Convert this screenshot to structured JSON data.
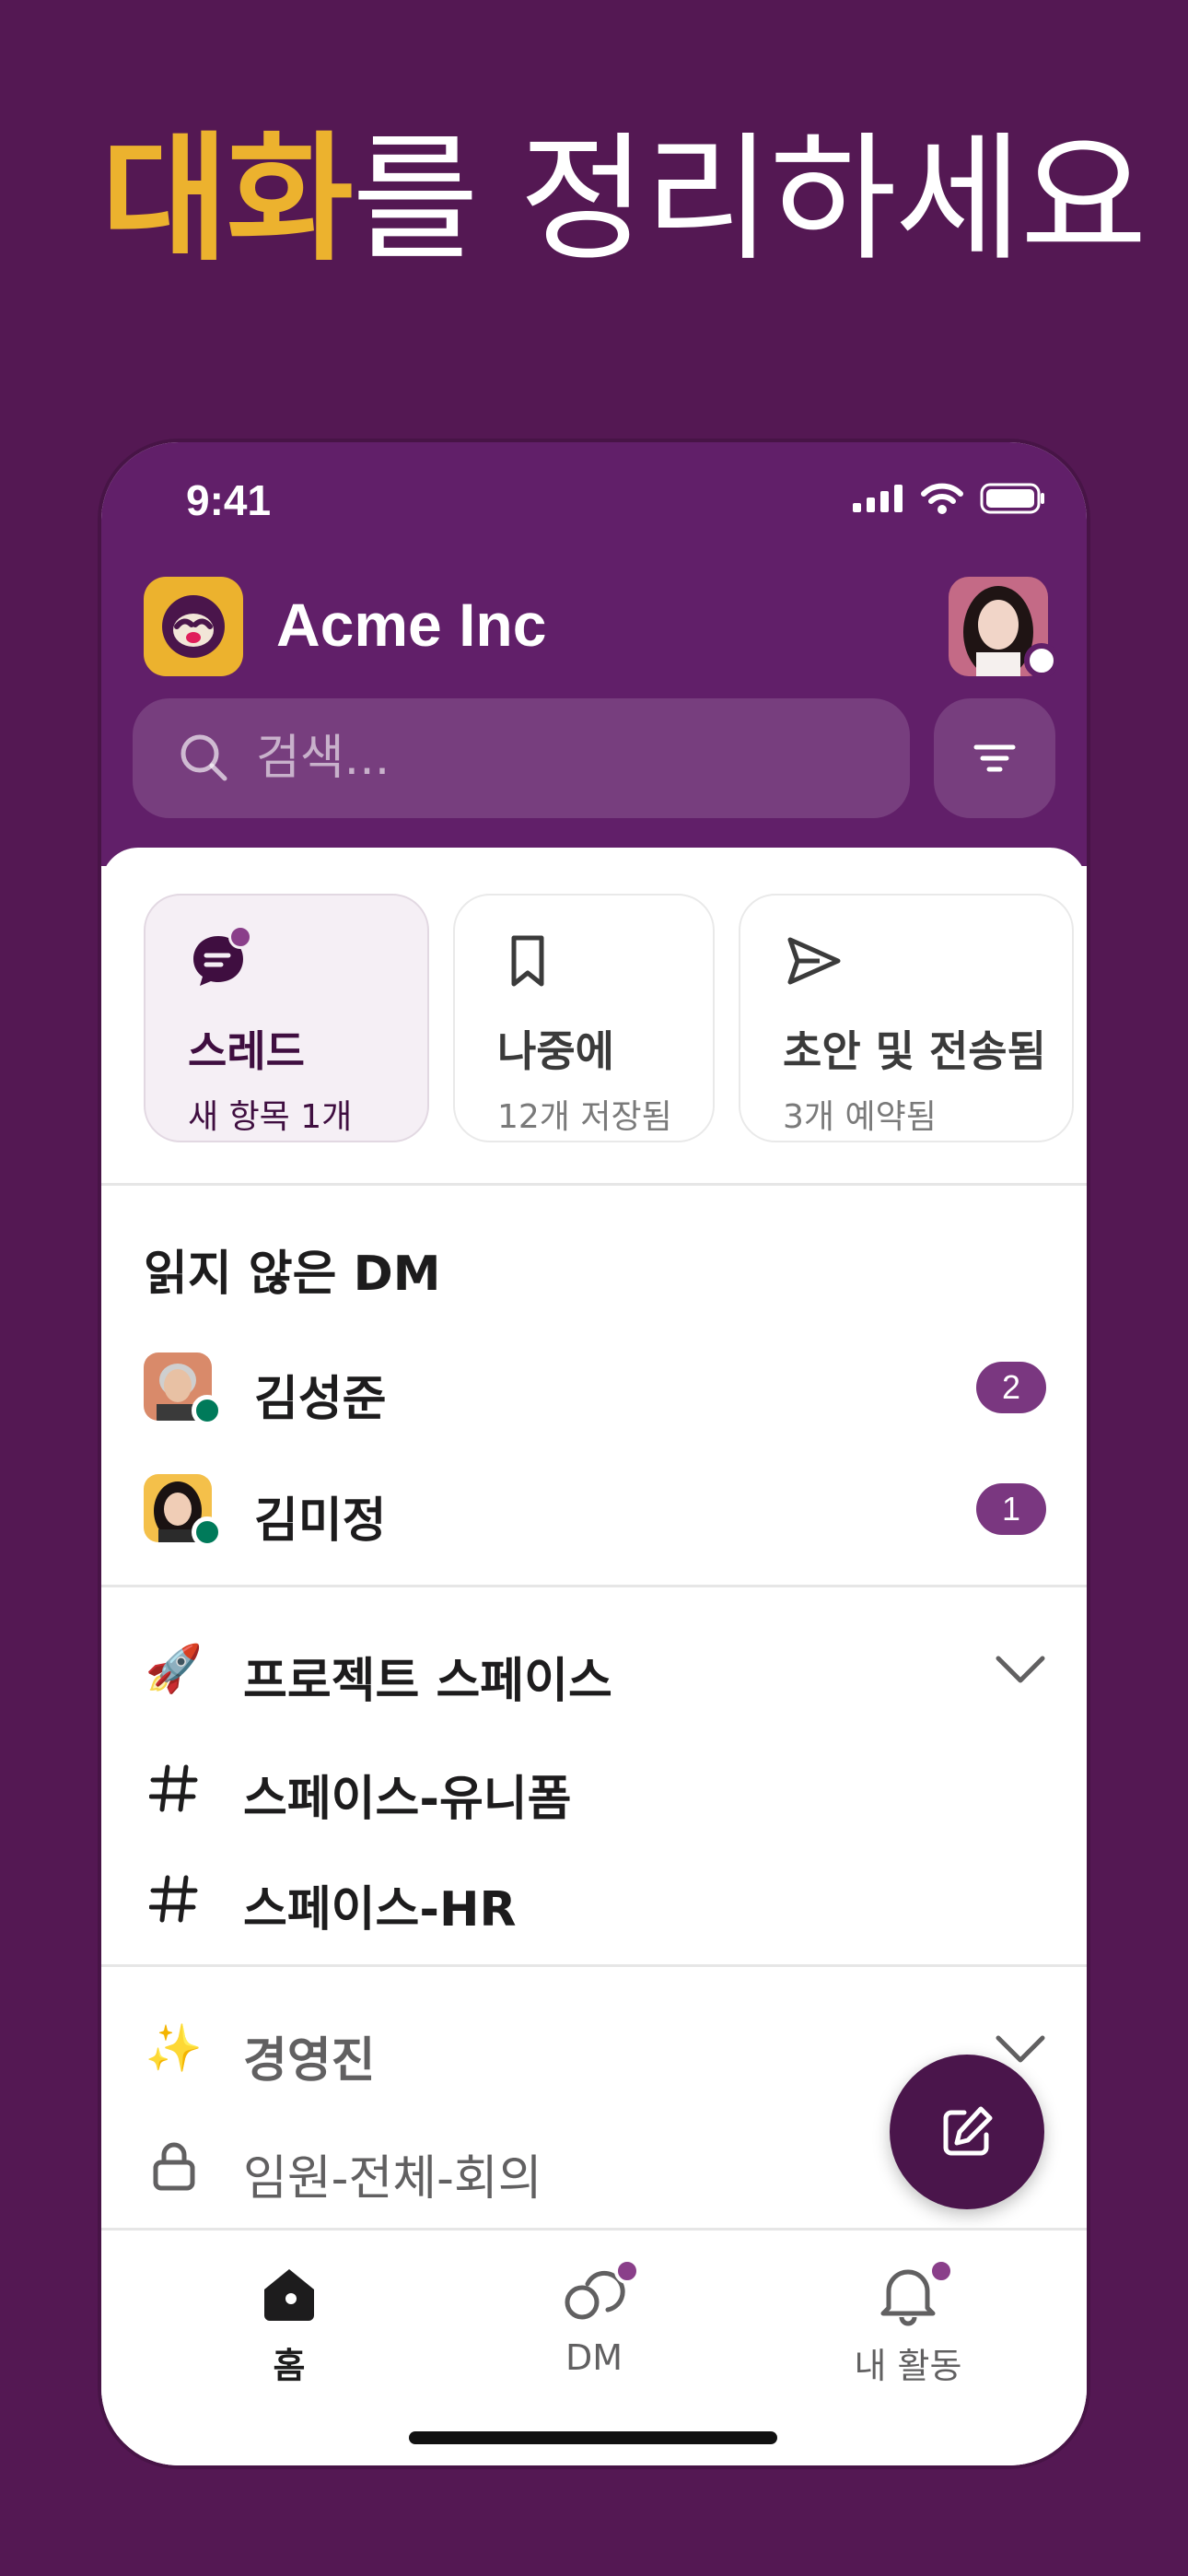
{
  "headline": {
    "accent": "대화",
    "rest": "를 정리하세요"
  },
  "status": {
    "time": "9:41"
  },
  "workspace": {
    "name": "Acme Inc"
  },
  "search": {
    "placeholder": "검색..."
  },
  "cards": [
    {
      "title": "스레드",
      "subtitle": "새 항목 1개",
      "icon": "thread-icon"
    },
    {
      "title": "나중에",
      "subtitle": "12개 저장됨",
      "icon": "bookmark-icon"
    },
    {
      "title": "초안 및 전송됨",
      "subtitle": "3개 예약됨",
      "icon": "send-icon"
    }
  ],
  "unread_dm": {
    "title": "읽지 않은 DM",
    "items": [
      {
        "name": "김성준",
        "count": "2"
      },
      {
        "name": "김미정",
        "count": "1"
      }
    ]
  },
  "sections": [
    {
      "emoji": "🚀",
      "title": "프로젝트 스페이스",
      "channels": [
        {
          "name": "스페이스-유니폼",
          "icon": "hash-icon"
        },
        {
          "name": "스페이스-HR",
          "icon": "hash-icon"
        }
      ]
    },
    {
      "emoji": "✨",
      "title": "경영진",
      "channels": [
        {
          "name": "임원-전체-회의",
          "icon": "lock-icon"
        }
      ]
    }
  ],
  "tabs": [
    {
      "label": "홈",
      "icon": "home-icon",
      "active": true
    },
    {
      "label": "DM",
      "icon": "dm-icon"
    },
    {
      "label": "내 활동",
      "icon": "bell-icon"
    }
  ],
  "colors": {
    "aubergine": "#611F69",
    "background": "#541853",
    "accent": "#ECB22E",
    "online": "#007a5a",
    "badge": "#7a3780"
  }
}
